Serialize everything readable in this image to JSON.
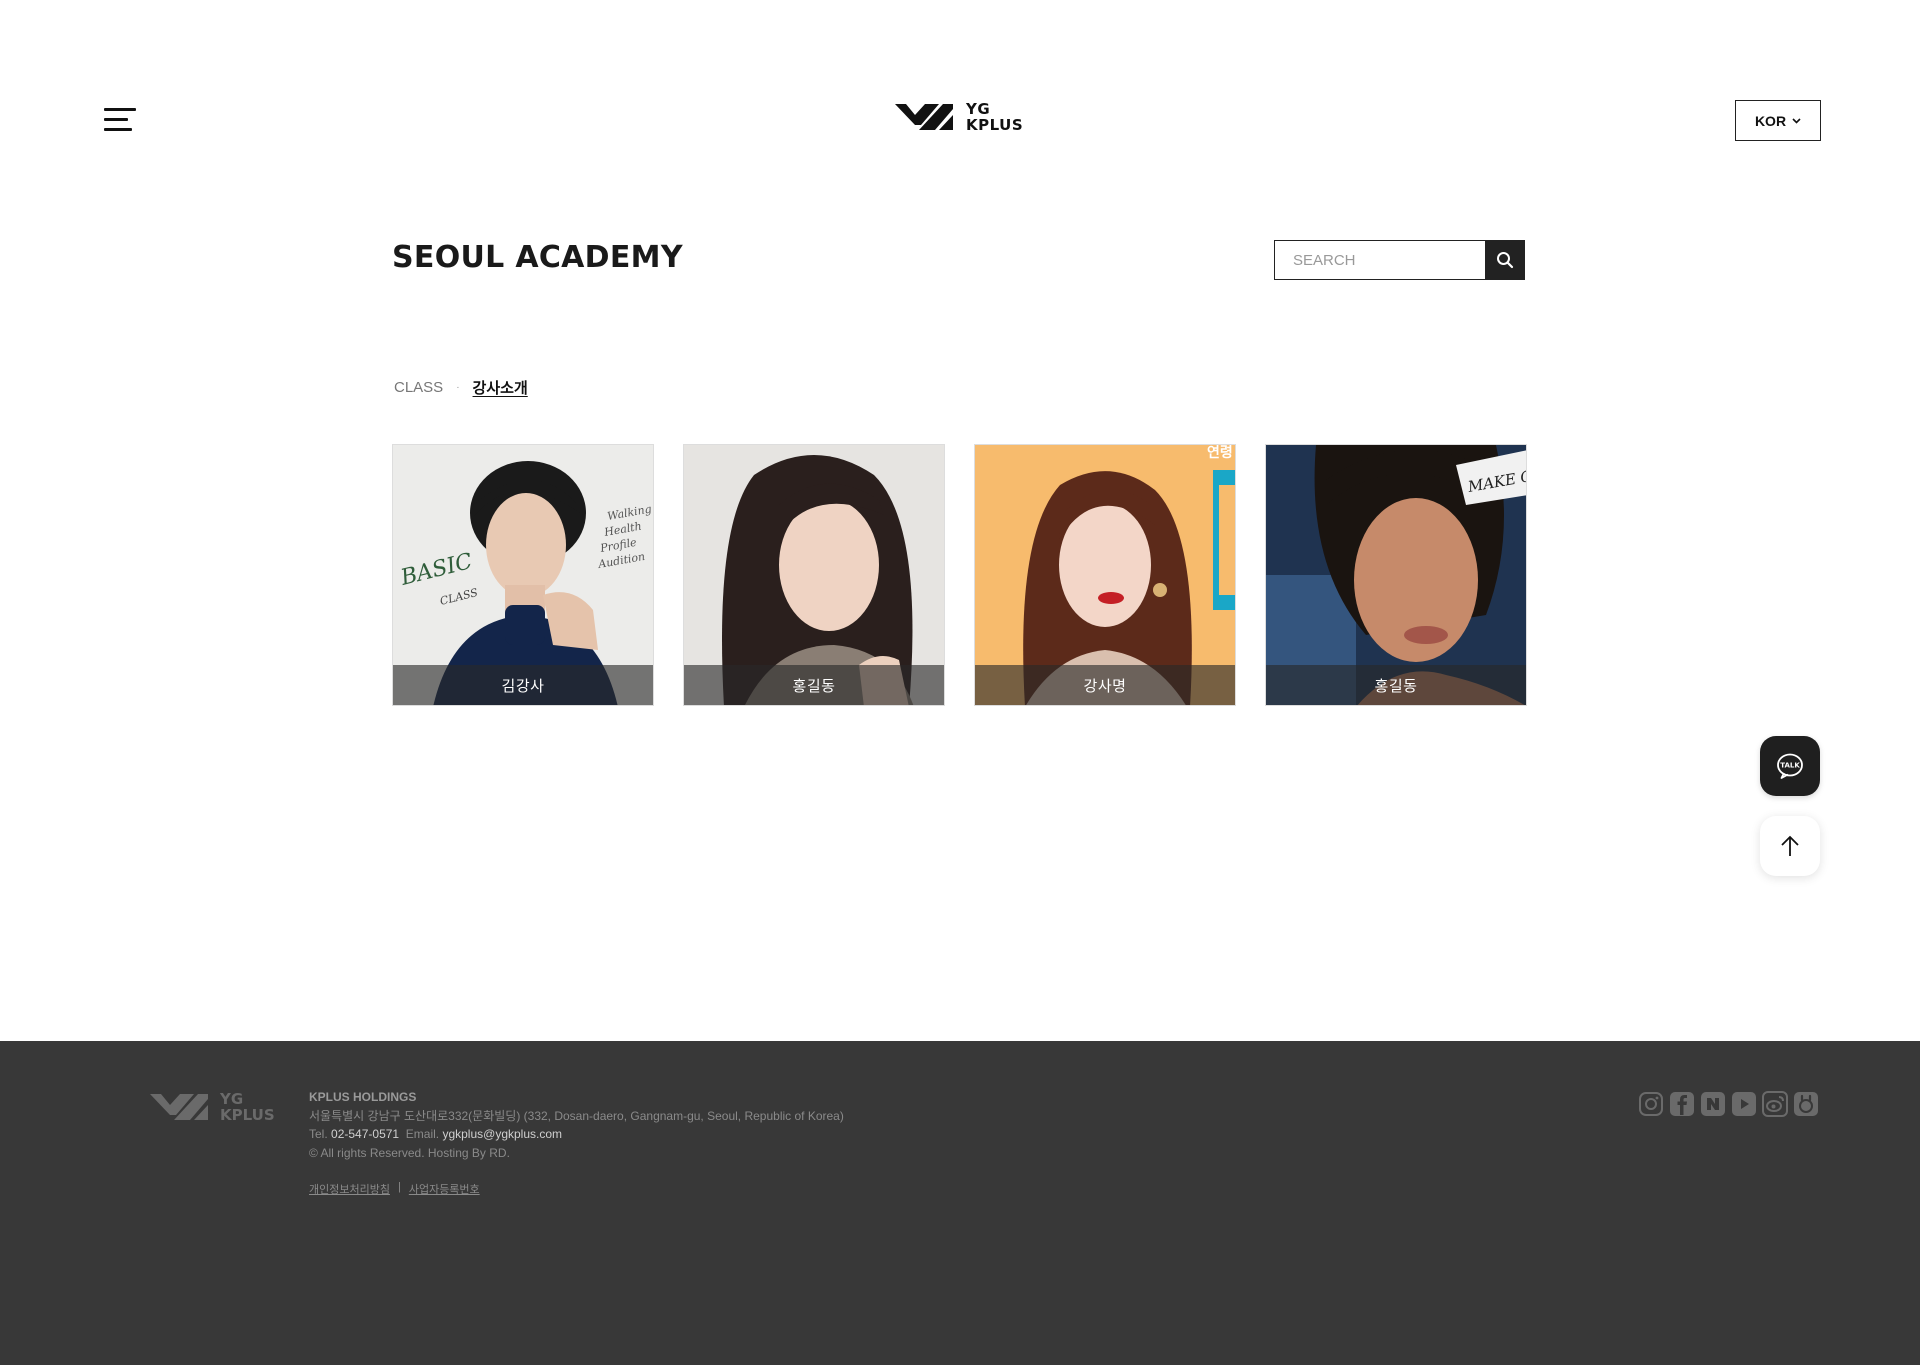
{
  "header": {
    "menu_icon": "hamburger-icon",
    "logo_line1": "YG",
    "logo_line2": "KPLUS",
    "language": "KOR"
  },
  "page": {
    "title": "SEOUL ACADEMY"
  },
  "search": {
    "placeholder": "SEARCH",
    "icon": "search-icon"
  },
  "breadcrumb": {
    "items": [
      "CLASS",
      "강사소개"
    ],
    "separator": "·"
  },
  "cards": [
    {
      "name": "김강사",
      "overlay_lines": [
        "Walking",
        "Health",
        "Profile",
        "Audition"
      ],
      "badge": "BASIC",
      "badge_sub": "CLASS"
    },
    {
      "name": "홍길동"
    },
    {
      "name": "강사명",
      "corner_text": "연령"
    },
    {
      "name": "홍길동",
      "tag_text": "MAKE O"
    }
  ],
  "floating": {
    "talk_label": "TALK",
    "top_icon": "arrow-up-icon"
  },
  "footer": {
    "logo_line1": "YG",
    "logo_line2": "KPLUS",
    "company": "KPLUS HOLDINGS",
    "address": "서울특별시 강남구 도산대로332(문화빌딩) (332, Dosan-daero, Gangnam-gu, Seoul, Republic of Korea)",
    "tel_label": "Tel.",
    "tel": "02-547-0571",
    "email_label": "Email.",
    "email": "ygkplus@ygkplus.com",
    "copyright": "© All rights Reserved. Hosting By RD.",
    "link_privacy": "개인정보처리방침",
    "link_separator": "|",
    "link_business": "사업자등록번호",
    "social": [
      "instagram-icon",
      "facebook-icon",
      "naver-blog-icon",
      "youtube-icon",
      "weibo-icon",
      "kakao-story-icon"
    ]
  },
  "colors": {
    "text": "#111111",
    "footer_bg": "#383838",
    "card_caption_bg": "rgba(40,40,40,0.62)",
    "card1_bg": "#e9e9e9",
    "card2_bg": "#e4e2df",
    "card3_bg": "#f6b86a",
    "card4_bg": "#1e3a5f"
  }
}
